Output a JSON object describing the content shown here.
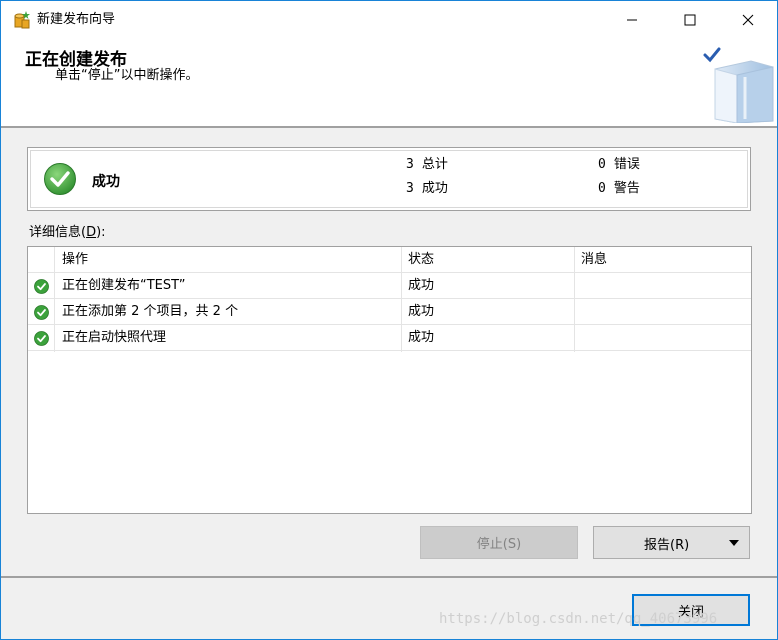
{
  "window": {
    "title": "新建发布向导",
    "controls": {
      "minimize": "minimize-icon",
      "maximize": "maximize-icon",
      "close": "close-icon"
    }
  },
  "header": {
    "title": "正在创建发布",
    "subtitle": "单击“停止”以中断操作。"
  },
  "summary": {
    "status": "成功",
    "total_count": "3",
    "total_label": "总计",
    "success_count": "3",
    "success_label": "成功",
    "error_count": "0",
    "error_label": "错误",
    "warning_count": "0",
    "warning_label": "警告"
  },
  "details": {
    "label_prefix": "详细信息(",
    "label_key": "D",
    "label_suffix": "):",
    "columns": {
      "action": "操作",
      "status": "状态",
      "message": "消息"
    },
    "rows": [
      {
        "action": "正在创建发布“TEST”",
        "status": "成功",
        "message": ""
      },
      {
        "action": "正在添加第 2 个项目，共 2 个",
        "status": "成功",
        "message": ""
      },
      {
        "action": "正在启动快照代理",
        "status": "成功",
        "message": ""
      }
    ]
  },
  "buttons": {
    "stop": "停止(S)",
    "report": "报告(R)",
    "close": "关闭"
  },
  "watermark": "https://blog.csdn.net/qq_40673996",
  "colors": {
    "accent": "#0078d7",
    "success": "#3ca23c"
  }
}
